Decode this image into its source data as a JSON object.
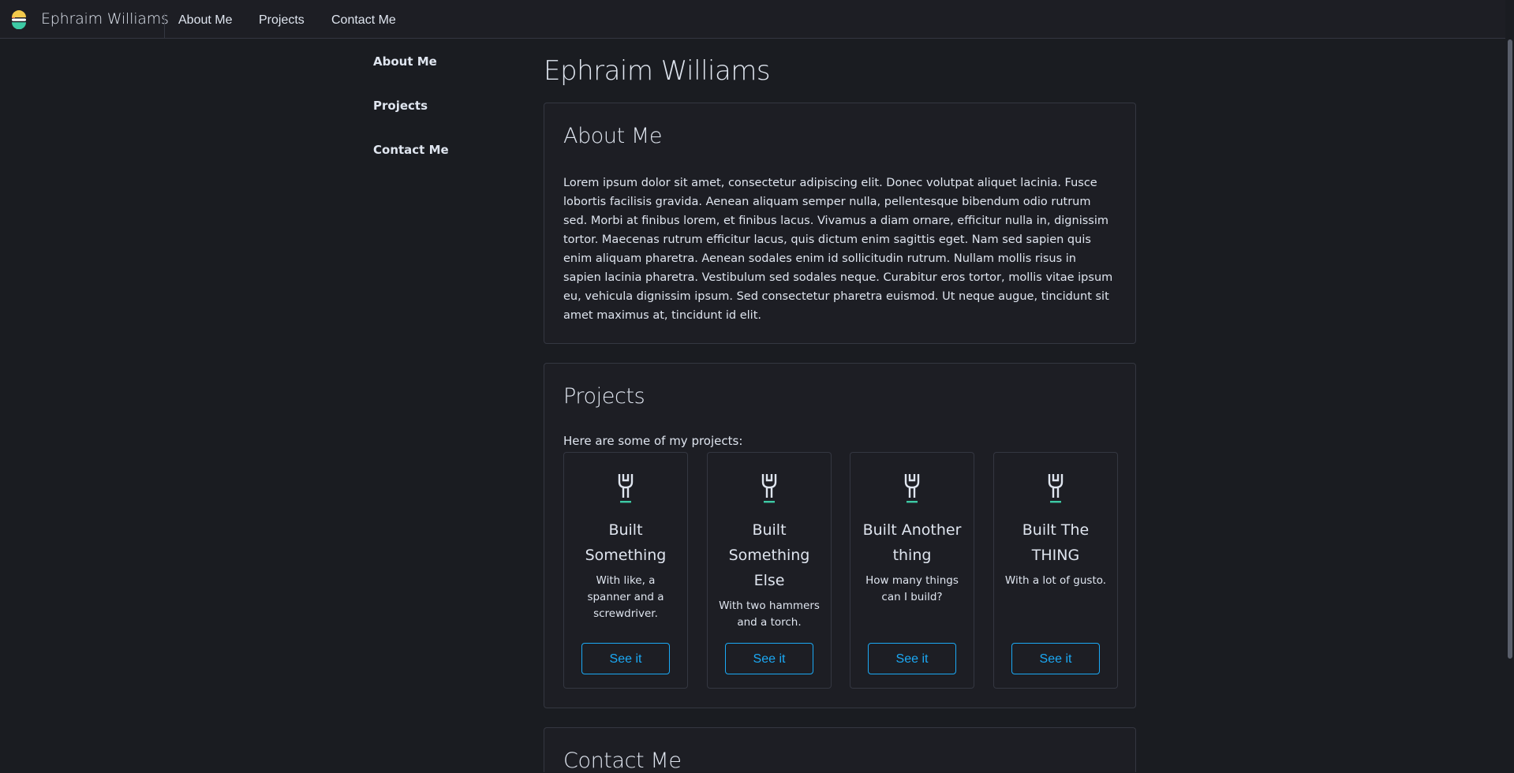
{
  "header": {
    "brand": "Ephraim Williams",
    "nav": [
      "About Me",
      "Projects",
      "Contact Me"
    ]
  },
  "sidebar": {
    "items": [
      "About Me",
      "Projects",
      "Contact Me"
    ]
  },
  "page": {
    "title": "Ephraim Williams"
  },
  "about": {
    "title": "About Me",
    "text": "Lorem ipsum dolor sit amet, consectetur adipiscing elit. Donec volutpat aliquet lacinia. Fusce lobortis facilisis gravida. Aenean aliquam semper nulla, pellentesque bibendum odio rutrum sed. Morbi at finibus lorem, et finibus lacus. Vivamus a diam ornare, efficitur nulla in, dignissim tortor. Maecenas rutrum efficitur lacus, quis dictum enim sagittis eget. Nam sed sapien quis enim aliquam pharetra. Aenean sodales enim id sollicitudin rutrum. Nullam mollis risus in sapien lacinia pharetra. Vestibulum sed sodales neque. Curabitur eros tortor, mollis vitae ipsum eu, vehicula dignissim ipsum. Sed consectetur pharetra euismod. Ut neque augue, tincidunt sit amet maximus at, tincidunt id elit."
  },
  "projects": {
    "title": "Projects",
    "intro": "Here are some of my projects:",
    "cards": [
      {
        "icon": "wrench-icon",
        "title": "Built Something",
        "desc": "With like, a spanner and a screwdriver.",
        "button": "See it"
      },
      {
        "icon": "wrench-icon",
        "title": "Built Something Else",
        "desc": "With two hammers and a torch.",
        "button": "See it"
      },
      {
        "icon": "wrench-icon",
        "title": "Built Another thing",
        "desc": "How many things can I build?",
        "button": "See it"
      },
      {
        "icon": "wrench-icon",
        "title": "Built The THING",
        "desc": "With a lot of gusto.",
        "button": "See it"
      }
    ]
  },
  "contact": {
    "title": "Contact Me"
  },
  "colors": {
    "background": "#1a1c21",
    "panel": "#1d1e24",
    "border": "#343741",
    "text": "#dfe5ef",
    "accent": "#1ba9f5",
    "icon_accent": "#3dcaa5"
  }
}
